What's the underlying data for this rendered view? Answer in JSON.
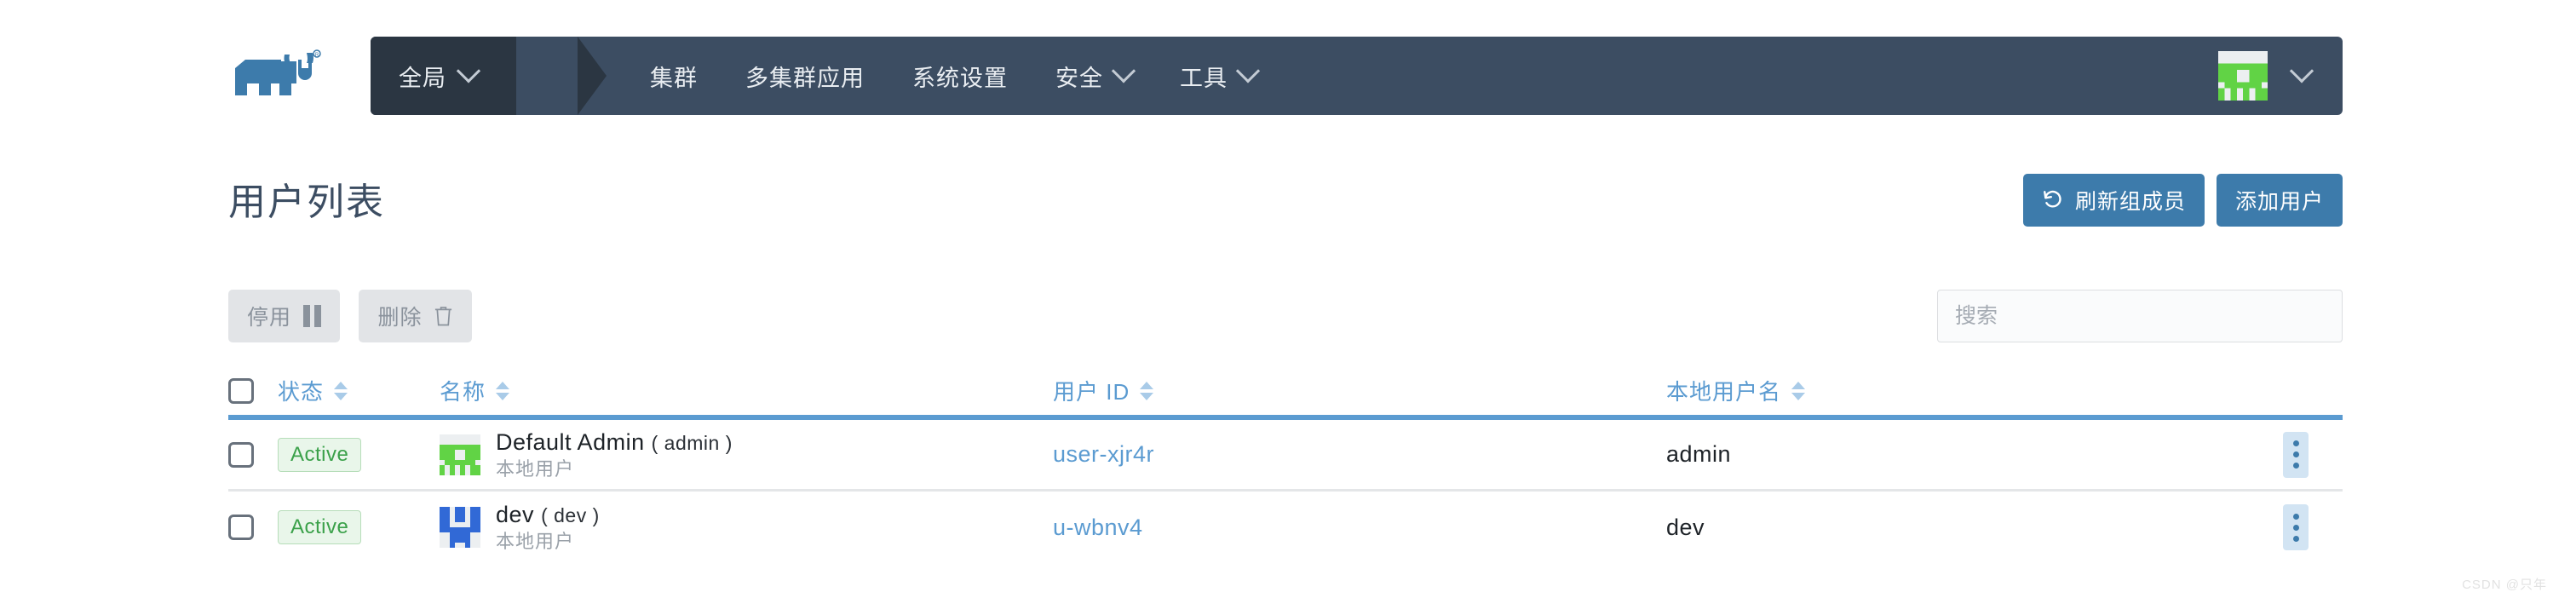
{
  "brand": {
    "logo_name": "rancher-logo",
    "logo_color": "#3d7bab"
  },
  "nav": {
    "scope": {
      "label": "全局",
      "caret": "chevron-down-icon"
    },
    "items": [
      {
        "label": "集群",
        "has_caret": false
      },
      {
        "label": "多集群应用",
        "has_caret": false
      },
      {
        "label": "系统设置",
        "has_caret": false
      },
      {
        "label": "安全",
        "has_caret": true
      },
      {
        "label": "工具",
        "has_caret": true
      }
    ],
    "user_menu": {
      "avatar": "user-avatar-identicon",
      "caret": "chevron-down-icon"
    }
  },
  "header": {
    "title": "用户列表",
    "refresh_members_label": "刷新组成员",
    "refresh_icon": "refresh-icon",
    "add_user_label": "添加用户"
  },
  "toolbar": {
    "deactivate_label": "停用",
    "deactivate_icon": "pause-icon",
    "delete_label": "删除",
    "delete_icon": "trash-icon",
    "search_placeholder": "搜索",
    "search_value": ""
  },
  "table": {
    "columns": [
      {
        "key": "state",
        "label": "状态",
        "sortable": true
      },
      {
        "key": "name",
        "label": "名称",
        "sortable": true
      },
      {
        "key": "uid",
        "label": "用户 ID",
        "sortable": true
      },
      {
        "key": "local",
        "label": "本地用户名",
        "sortable": true
      }
    ],
    "select_all_checked": false,
    "rows": [
      {
        "checked": false,
        "state": "Active",
        "avatar": "identicon-green",
        "avatar_color": "#61d345",
        "name": "Default Admin",
        "name_paren": "( admin )",
        "subtitle": "本地用户",
        "uid": "user-xjr4r",
        "local_username": "admin",
        "actions_icon": "kebab-menu-icon"
      },
      {
        "checked": false,
        "state": "Active",
        "avatar": "identicon-blue",
        "avatar_color": "#3169d6",
        "name": "dev",
        "name_paren": "( dev )",
        "subtitle": "本地用户",
        "uid": "u-wbnv4",
        "local_username": "dev",
        "actions_icon": "kebab-menu-icon"
      }
    ]
  },
  "watermark": {
    "text": "CSDN @只年"
  },
  "colors": {
    "nav_bg": "#3c4d62",
    "nav_scope_bg": "#2b3642",
    "primary": "#3d7bab",
    "link": "#5b9bd1",
    "active_green": "#3ba14a"
  }
}
